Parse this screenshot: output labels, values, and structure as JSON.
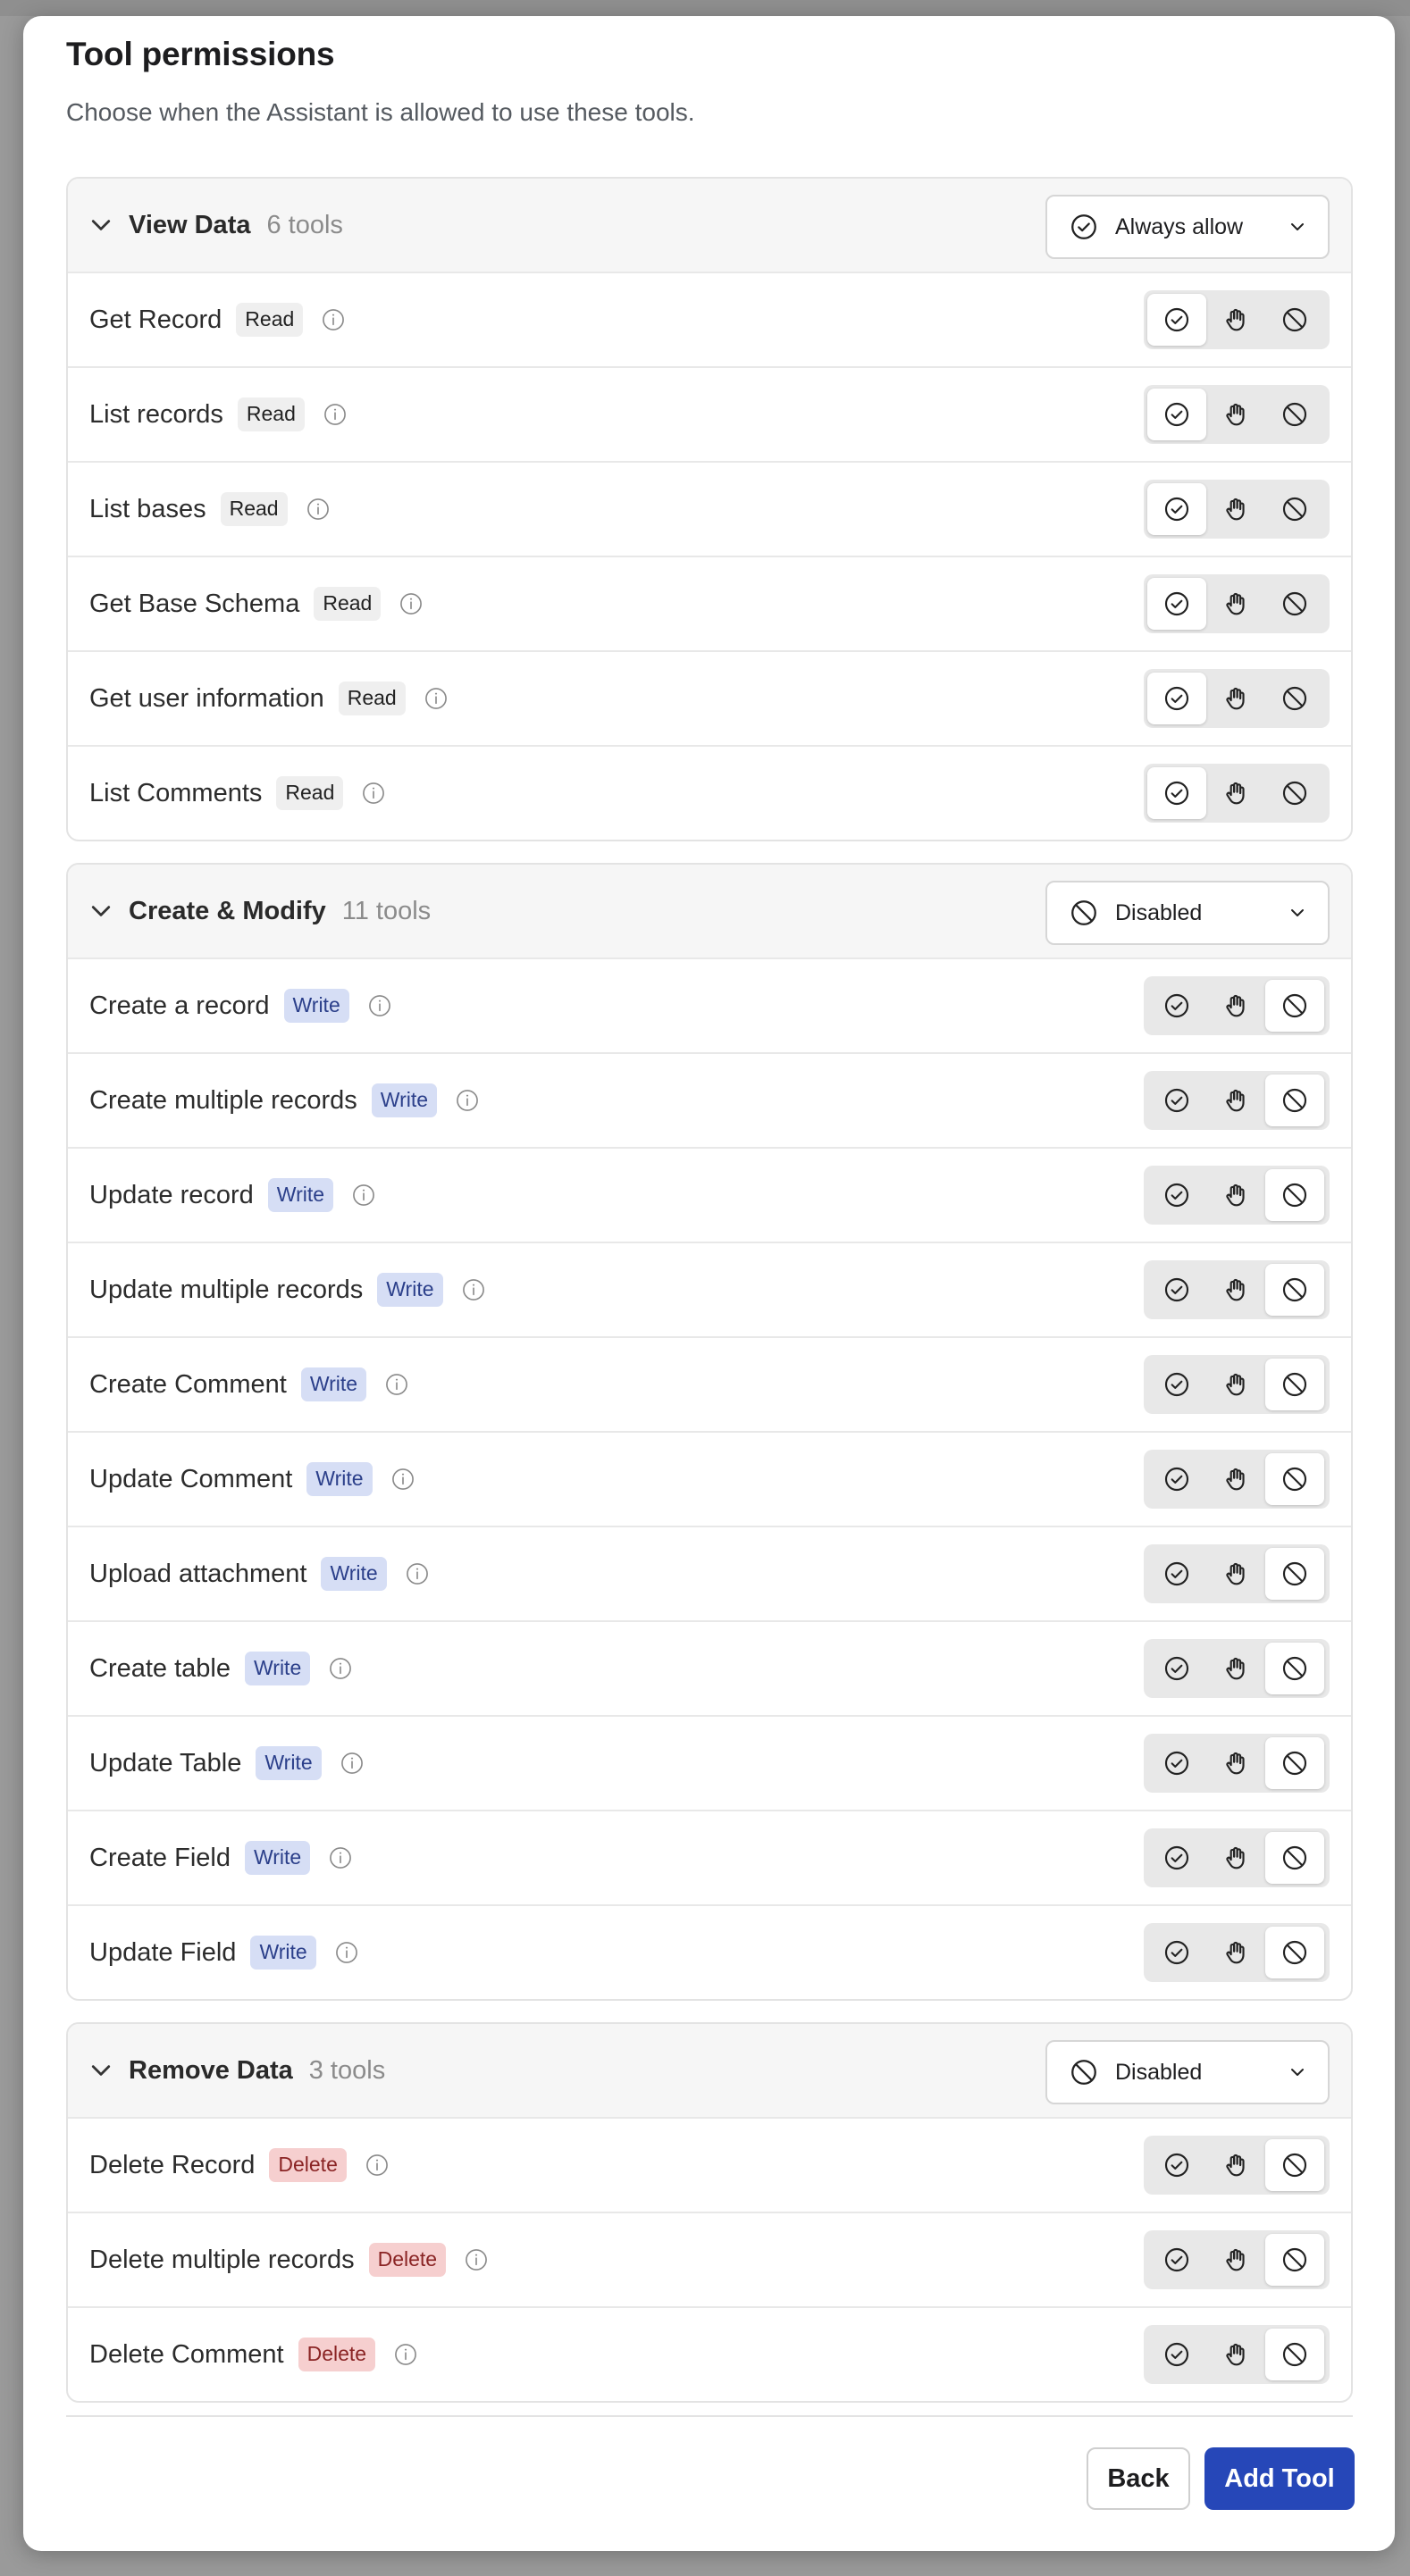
{
  "modal": {
    "title": "Tool permissions",
    "subtitle": "Choose when the Assistant is allowed to use these tools."
  },
  "groups": [
    {
      "name": "View Data",
      "count": "6 tools",
      "policy": "Always allow",
      "policy_icon": "check-circle-icon",
      "tools": [
        {
          "name": "Get Record",
          "tag": "Read",
          "tag_type": "read",
          "selected": "allow"
        },
        {
          "name": "List records",
          "tag": "Read",
          "tag_type": "read",
          "selected": "allow"
        },
        {
          "name": "List bases",
          "tag": "Read",
          "tag_type": "read",
          "selected": "allow"
        },
        {
          "name": "Get Base Schema",
          "tag": "Read",
          "tag_type": "read",
          "selected": "allow"
        },
        {
          "name": "Get user information",
          "tag": "Read",
          "tag_type": "read",
          "selected": "allow"
        },
        {
          "name": "List Comments",
          "tag": "Read",
          "tag_type": "read",
          "selected": "allow"
        }
      ]
    },
    {
      "name": "Create & Modify",
      "count": "11 tools",
      "policy": "Disabled",
      "policy_icon": "ban-icon",
      "tools": [
        {
          "name": "Create a record",
          "tag": "Write",
          "tag_type": "write",
          "selected": "disabled"
        },
        {
          "name": "Create multiple records",
          "tag": "Write",
          "tag_type": "write",
          "selected": "disabled"
        },
        {
          "name": "Update record",
          "tag": "Write",
          "tag_type": "write",
          "selected": "disabled"
        },
        {
          "name": "Update multiple records",
          "tag": "Write",
          "tag_type": "write",
          "selected": "disabled"
        },
        {
          "name": "Create Comment",
          "tag": "Write",
          "tag_type": "write",
          "selected": "disabled"
        },
        {
          "name": "Update Comment",
          "tag": "Write",
          "tag_type": "write",
          "selected": "disabled"
        },
        {
          "name": "Upload attachment",
          "tag": "Write",
          "tag_type": "write",
          "selected": "disabled"
        },
        {
          "name": "Create table",
          "tag": "Write",
          "tag_type": "write",
          "selected": "disabled"
        },
        {
          "name": "Update Table",
          "tag": "Write",
          "tag_type": "write",
          "selected": "disabled"
        },
        {
          "name": "Create Field",
          "tag": "Write",
          "tag_type": "write",
          "selected": "disabled"
        },
        {
          "name": "Update Field",
          "tag": "Write",
          "tag_type": "write",
          "selected": "disabled"
        }
      ]
    },
    {
      "name": "Remove Data",
      "count": "3 tools",
      "policy": "Disabled",
      "policy_icon": "ban-icon",
      "tools": [
        {
          "name": "Delete Record",
          "tag": "Delete",
          "tag_type": "delete",
          "selected": "disabled"
        },
        {
          "name": "Delete multiple records",
          "tag": "Delete",
          "tag_type": "delete",
          "selected": "disabled"
        },
        {
          "name": "Delete Comment",
          "tag": "Delete",
          "tag_type": "delete",
          "selected": "disabled"
        }
      ]
    }
  ],
  "footer": {
    "back_label": "Back",
    "add_label": "Add Tool"
  },
  "colors": {
    "primary": "#2647b8",
    "write_badge": "#d6def5",
    "delete_badge": "#f6cfcf",
    "read_badge": "#efefef"
  }
}
